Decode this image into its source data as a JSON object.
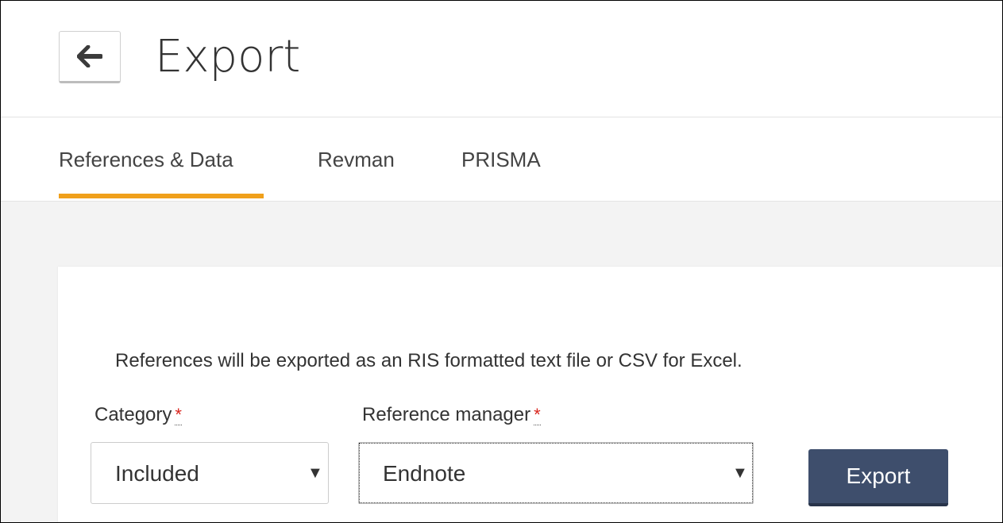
{
  "header": {
    "title": "Export",
    "back_icon": "arrow-left-icon"
  },
  "tabs": [
    {
      "label": "References & Data",
      "active": true
    },
    {
      "label": "Revman",
      "active": false
    },
    {
      "label": "PRISMA",
      "active": false
    }
  ],
  "colors": {
    "tab_active_accent": "#f0a01b",
    "primary_button": "#3e4e6c",
    "required_marker": "#d9251d"
  },
  "panel": {
    "info_text": "References will be exported as an RIS formatted text file or CSV for Excel.",
    "category": {
      "label": "Category",
      "required_marker": "*",
      "value": "Included",
      "dropdown_icon": "caret-down-icon"
    },
    "reference_manager": {
      "label": "Reference manager",
      "required_marker": "*",
      "value": "Endnote",
      "dropdown_icon": "caret-down-icon"
    },
    "export_button_label": "Export"
  }
}
